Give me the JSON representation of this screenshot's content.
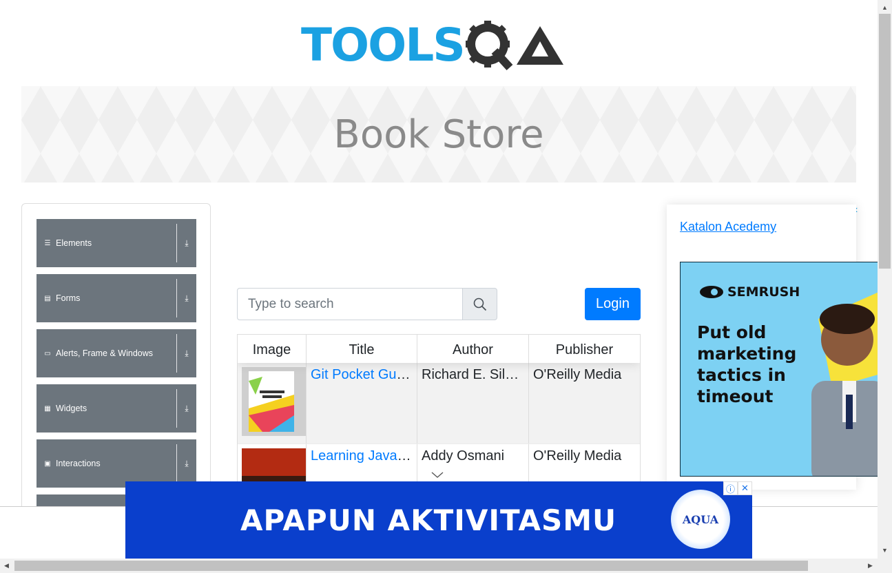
{
  "header": {
    "logo_part1": "TOOLS",
    "logo_part2": "QA"
  },
  "banner": {
    "title": "Book Store"
  },
  "sidebar": {
    "groups": [
      {
        "label": "Elements",
        "icon": "list-icon"
      },
      {
        "label": "Forms",
        "icon": "form-icon"
      },
      {
        "label": "Alerts, Frame & Windows",
        "icon": "window-icon"
      },
      {
        "label": "Widgets",
        "icon": "widgets-icon"
      },
      {
        "label": "Interactions",
        "icon": "interactions-icon"
      }
    ]
  },
  "search": {
    "placeholder": "Type to search"
  },
  "login": {
    "label": "Login"
  },
  "table": {
    "headers": [
      "Image",
      "Title",
      "Author",
      "Publisher"
    ],
    "rows": [
      {
        "title": "Git Pocket Guide",
        "author": "Richard E. Silverman",
        "publisher": "O'Reilly Media"
      },
      {
        "title": "Learning JavaScript Design Patterns",
        "author": "Addy Osmani",
        "publisher": "O'Reilly Media"
      }
    ]
  },
  "right_ad": {
    "link_text": "Katalon Acedemy",
    "brand": "SEMRUSH",
    "message": "Put old marketing tactics in timeout"
  },
  "bottom_ad": {
    "headline": "APAPUN AKTIVITASMU",
    "brand": "AQUA"
  },
  "colors": {
    "accent": "#007bff",
    "sidebar": "#6c757d",
    "logo_blue": "#1ba1e2",
    "bottom_ad": "#0a3fcc",
    "ad_bg": "#7dd1f3"
  }
}
